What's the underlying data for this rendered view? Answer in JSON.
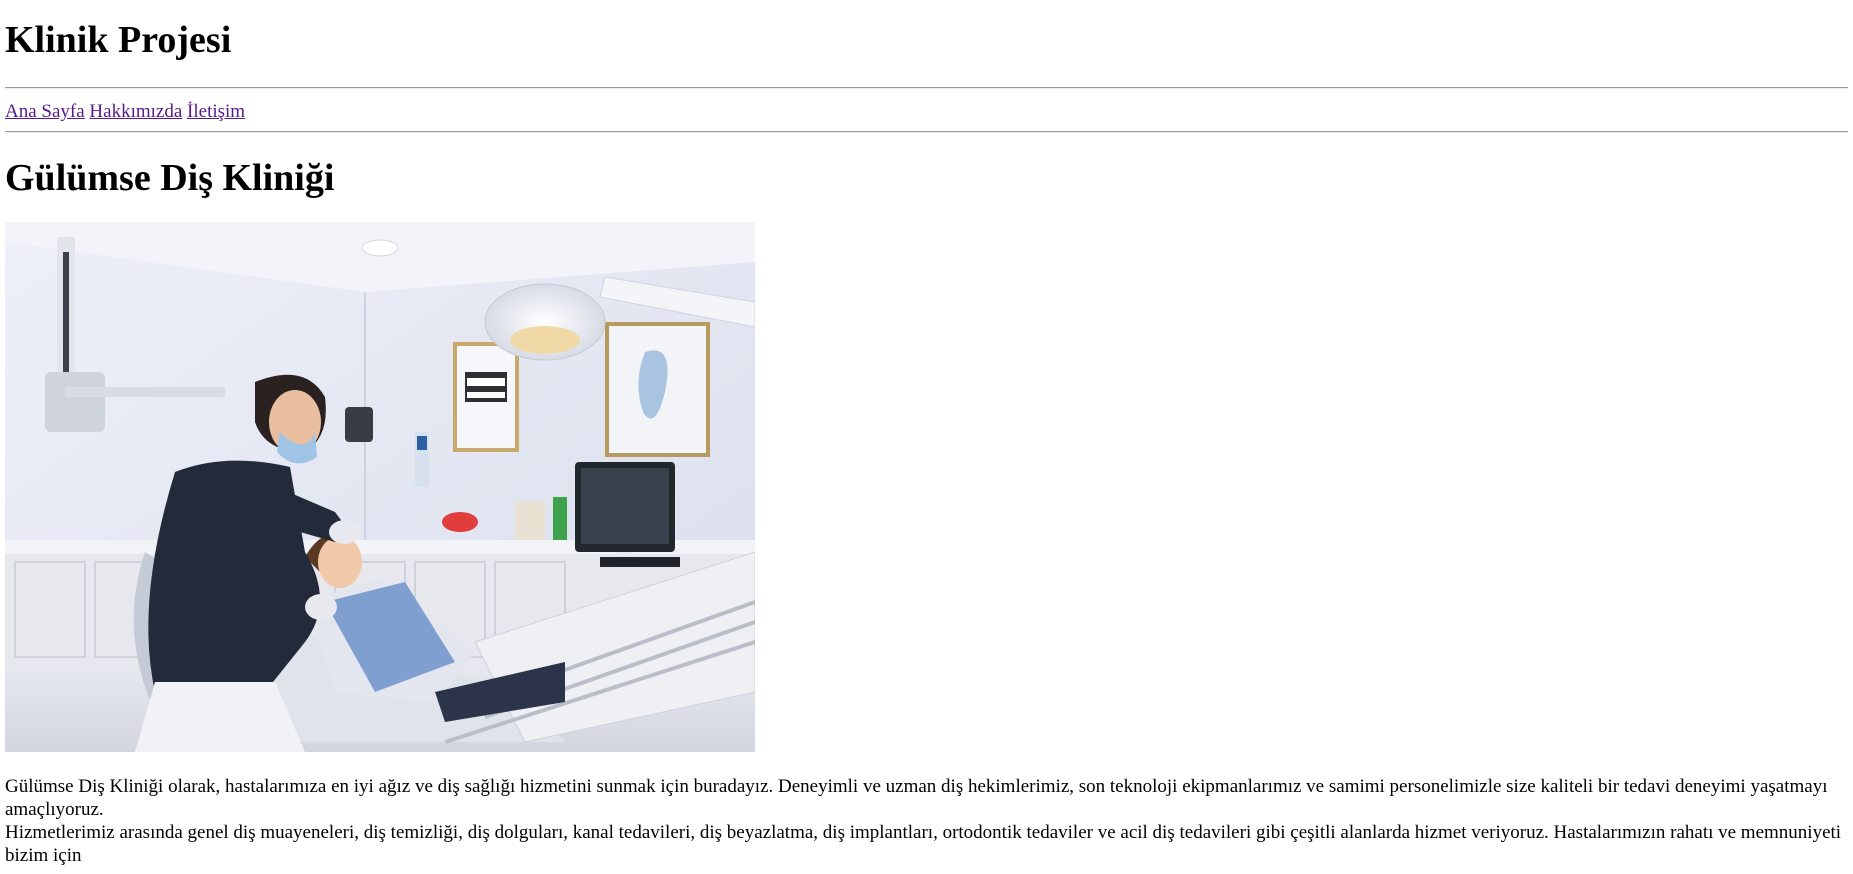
{
  "site": {
    "title": "Klinik Projesi"
  },
  "nav": {
    "items": [
      {
        "label": "Ana Sayfa"
      },
      {
        "label": "Hakkımızda"
      },
      {
        "label": "İletişim"
      }
    ]
  },
  "clinic": {
    "title": "Gülümse Diş Kliniği",
    "image_alt": "Diş kliniği muayene odası",
    "paragraphs": [
      "Gülümse Diş Kliniği olarak, hastalarımıza en iyi ağız ve diş sağlığı hizmetini sunmak için buradayız. Deneyimli ve uzman diş hekimlerimiz, son teknoloji ekipmanlarımız ve samimi personelimizle size kaliteli bir tedavi deneyimi yaşatmayı amaçlıyoruz.",
      "Hizmetlerimiz arasında genel diş muayeneleri, diş temizliği, diş dolguları, kanal tedavileri, diş beyazlatma, diş implantları, ortodontik tedaviler ve acil diş tedavileri gibi çeşitli alanlarda hizmet veriyoruz. Hastalarımızın rahatı ve memnuniyeti bizim için"
    ]
  },
  "colors": {
    "link_visited": "#551a8b",
    "text": "#000000",
    "rule": "#9a9a9a"
  }
}
